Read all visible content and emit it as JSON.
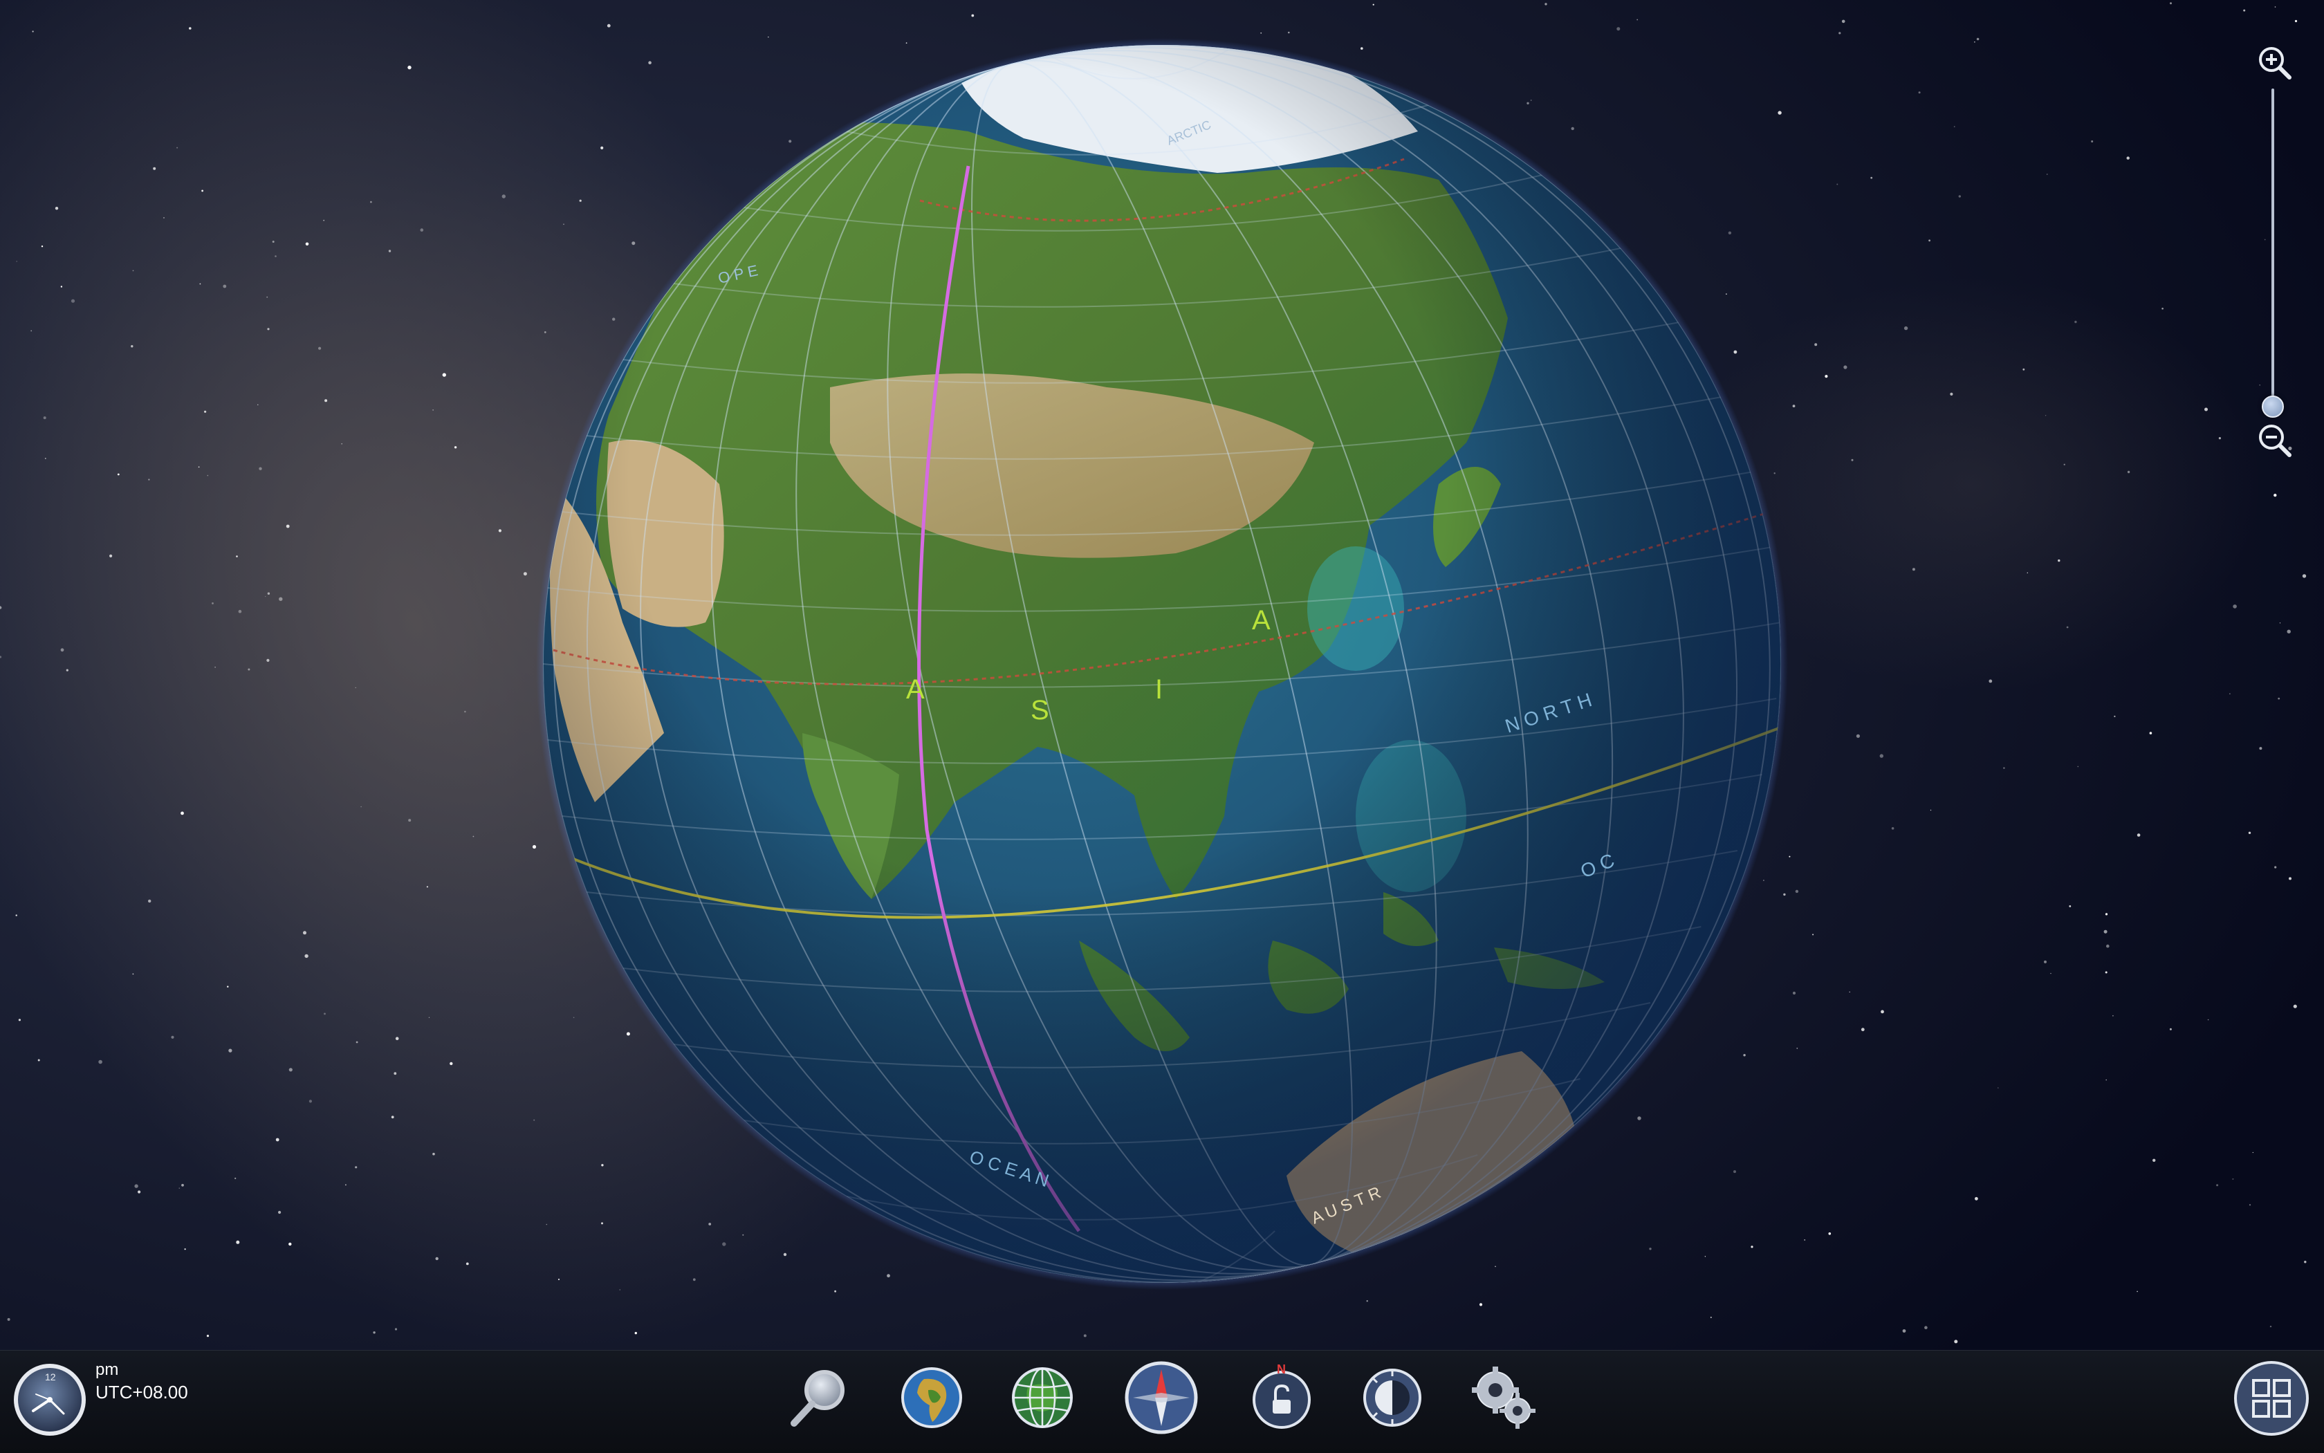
{
  "globe": {
    "continent_labels": {
      "asia": [
        "A",
        "S",
        "I",
        "A"
      ]
    },
    "ocean_label_north": "N O R T H",
    "ocean_label_pacific": "O   C",
    "indian_ocean_label": "O C E A N",
    "arctic_label": "ARCTIC",
    "europe_label": "O P E",
    "australia_label": "A U S T R",
    "colors": {
      "prime_meridian": "#d56be2",
      "equator": "#d9cf3a",
      "tropic": "#d14a3c",
      "arctic_circle": "#d14a3c",
      "continent_label": "#b9e23b",
      "ocean_label": "#7fb2d6"
    }
  },
  "zoom": {
    "level": 0.0
  },
  "status": {
    "period": "pm",
    "utc_offset": "UTC+08.00"
  },
  "clock": {
    "hour_label": "12"
  },
  "toolbar": {
    "tools": [
      {
        "name": "search-icon"
      },
      {
        "name": "africa-globe-icon"
      },
      {
        "name": "grid-globe-icon"
      },
      {
        "name": "compass-icon"
      },
      {
        "name": "north-lock-icon",
        "badge": "N"
      },
      {
        "name": "day-night-icon"
      },
      {
        "name": "settings-gear-icon"
      }
    ]
  },
  "layout_button": {
    "name": "layout-grid-icon"
  }
}
